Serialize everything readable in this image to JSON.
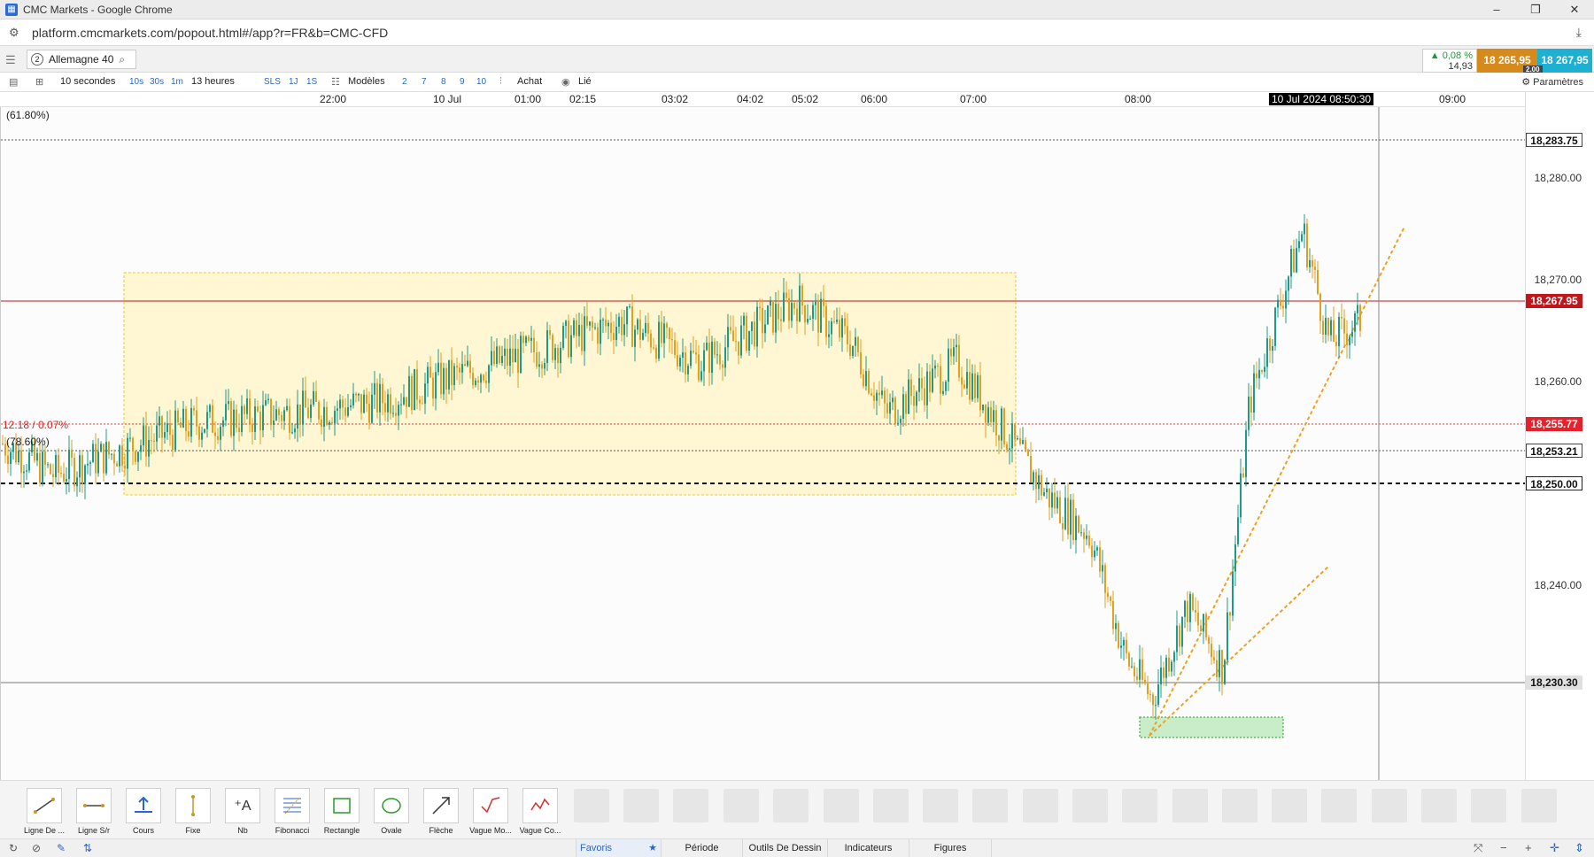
{
  "window": {
    "title": "CMC Markets - Google Chrome",
    "url": "platform.cmcmarkets.com/popout.html#/app?r=FR&b=CMC-CFD",
    "controls": [
      "–",
      "❐",
      "✕"
    ]
  },
  "header": {
    "instrument_number": "2",
    "instrument_name": "Allemagne 40",
    "change_pct": "▲ 0,08 %",
    "change_abs": "14,93",
    "sell_price": "18 265,95",
    "buy_price": "18 267,95",
    "spread": "2.00"
  },
  "toolbar": {
    "period": "10 secondes",
    "tf_10s": "10s",
    "tf_30s": "30s",
    "tf_1m": "1m",
    "duration": "13 heures",
    "sls": "SLS",
    "d1": "1J",
    "s1": "1S",
    "models": "Modèles",
    "n2": "2",
    "n7": "7",
    "n8": "8",
    "n9": "9",
    "n10": "10",
    "buy_label": "Achat",
    "linked": "Lié",
    "settings": "Paramètres"
  },
  "time_axis": {
    "ticks": [
      "22:00",
      "10 Jul",
      "01:00",
      "02:15",
      "03:02",
      "04:02",
      "05:02",
      "06:00",
      "07:00",
      "08:00",
      "09:00"
    ],
    "crosshair_date": "10 Jul 2024 08:50:30"
  },
  "price_axis": {
    "levels": [
      "18,280.00",
      "18,270.00",
      "18,260.00",
      "18,240.00"
    ],
    "tag_fib618": "18,283.75",
    "tag_current": "18,267.95",
    "tag_red": "18,255.77",
    "tag_fib786": "18,253.21",
    "tag_dashed": "18,250.00",
    "tag_hline": "18,230.30"
  },
  "chart_labels": {
    "fib618": "(61.80%)",
    "fib786": "(78.60%)",
    "change_label": "12.18 / 0.07%"
  },
  "chart_data": {
    "type": "line",
    "title": "",
    "ylim": [
      18225,
      18286
    ],
    "x": [
      "21:30",
      "22:00",
      "23:00",
      "00:00",
      "01:00",
      "02:00",
      "03:00",
      "04:00",
      "05:00",
      "06:00",
      "06:30",
      "07:00",
      "07:20",
      "07:30",
      "07:45",
      "08:00",
      "08:10",
      "08:20",
      "08:30",
      "08:40",
      "08:45",
      "08:50"
    ],
    "values": [
      18254,
      18251,
      18256,
      18258,
      18263,
      18266,
      18262,
      18268,
      18264,
      18257,
      18262,
      18253,
      18249,
      18245,
      18233,
      18229,
      18238,
      18232,
      18258,
      18275,
      18264,
      18266
    ]
  },
  "colors": {
    "candle_up": "#1f9a8a",
    "candle_down": "#e0a020",
    "current_price": "#c0171c",
    "range_box": "#fff4c8",
    "support_box": "#b4e6b4",
    "trendline": "#f0a020"
  },
  "draw_tools": [
    {
      "label": "Ligne De ...",
      "icon": "line-icon"
    },
    {
      "label": "Ligne S/r",
      "icon": "sr-line-icon"
    },
    {
      "label": "Cours",
      "icon": "price-line-icon"
    },
    {
      "label": "Fixe",
      "icon": "fixed-line-icon"
    },
    {
      "label": "Nb",
      "icon": "text-note-icon"
    },
    {
      "label": "Fibonacci",
      "icon": "fibonacci-icon"
    },
    {
      "label": "Rectangle",
      "icon": "rectangle-icon"
    },
    {
      "label": "Ovale",
      "icon": "oval-icon"
    },
    {
      "label": "Flèche",
      "icon": "arrow-icon"
    },
    {
      "label": "Vague Mo...",
      "icon": "wave-icon"
    },
    {
      "label": "Vague Co...",
      "icon": "wave-corrective-icon"
    }
  ],
  "bottom_tabs": {
    "favorites": "Favoris",
    "period": "Période",
    "drawing_tools": "Outils De Dessin",
    "indicators": "Indicateurs",
    "figures": "Figures"
  }
}
